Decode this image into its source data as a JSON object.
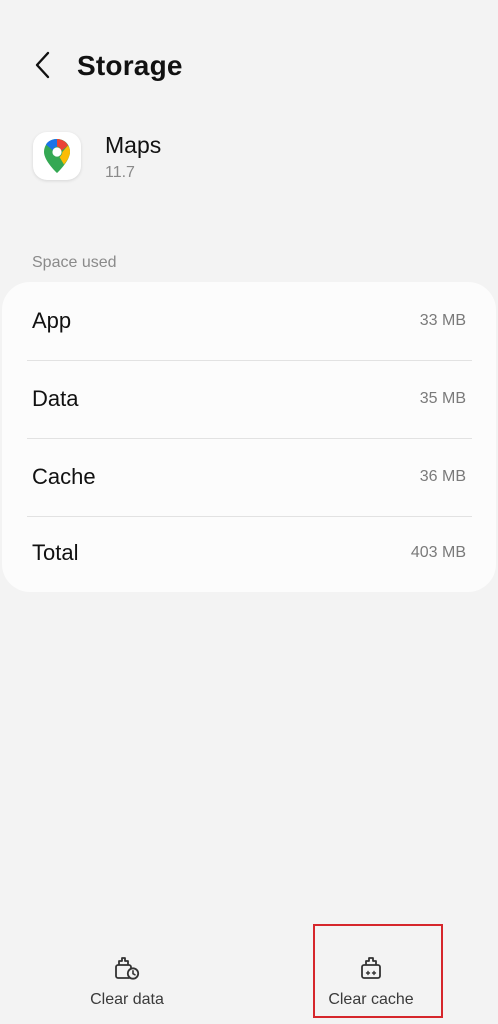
{
  "header": {
    "title": "Storage"
  },
  "app": {
    "name": "Maps",
    "version": "11.7",
    "icon": "google-maps-icon"
  },
  "space_used": {
    "label": "Space used",
    "rows": [
      {
        "label": "App",
        "value": "33 MB"
      },
      {
        "label": "Data",
        "value": "35 MB"
      },
      {
        "label": "Cache",
        "value": "36 MB"
      },
      {
        "label": "Total",
        "value": "403 MB"
      }
    ]
  },
  "actions": {
    "clear_data": {
      "label": "Clear data",
      "icon": "clear-data-icon"
    },
    "clear_cache": {
      "label": "Clear cache",
      "icon": "clear-cache-icon"
    }
  },
  "colors": {
    "highlight": "#d6262b",
    "background": "#f3f3f3",
    "card": "#fcfcfc"
  }
}
